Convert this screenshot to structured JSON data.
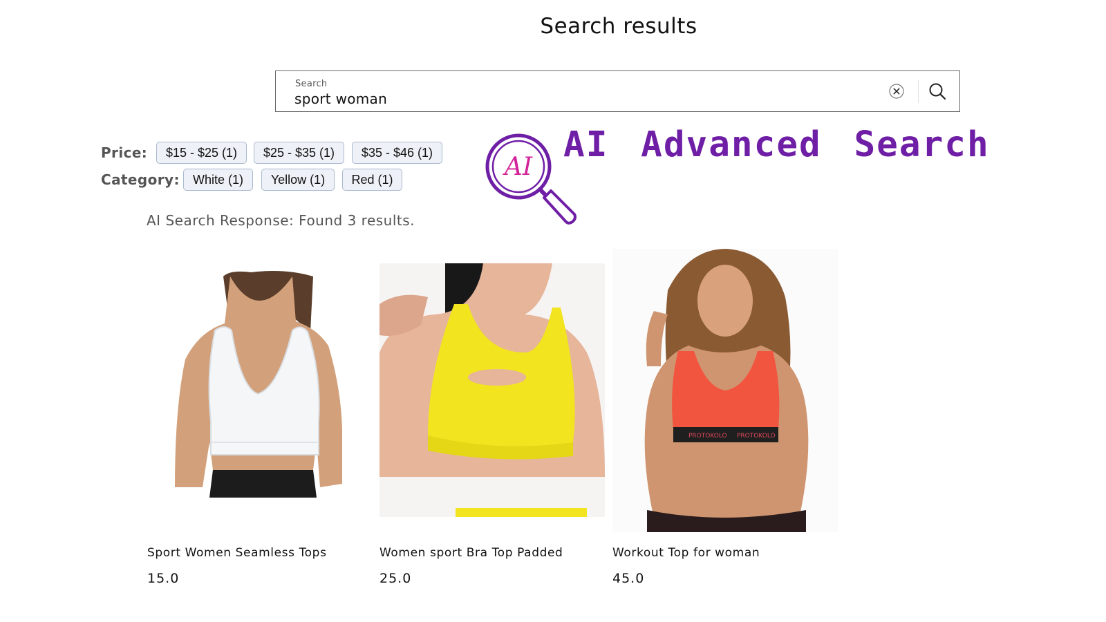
{
  "page": {
    "title": "Search results"
  },
  "search": {
    "label": "Search",
    "value": "sport woman",
    "clear_icon": "close-circle-icon",
    "submit_icon": "search-icon"
  },
  "filters": {
    "price_label": "Price:",
    "price_options": [
      "$15 - $25 (1)",
      "$25 - $35 (1)",
      "$35 - $46 (1)"
    ],
    "category_label": "Category:",
    "category_options": [
      "White (1)",
      "Yellow (1)",
      "Red (1)"
    ]
  },
  "ai": {
    "heading": "AI Advanced Search",
    "logo_text": "AI",
    "response": "AI Search Response: Found 3 results.",
    "accent": "#6f1ea6",
    "logo_text_color": "#d4239a"
  },
  "products": [
    {
      "title": "Sport Women Seamless Tops",
      "price": "15.0",
      "color": "#f4f6f8"
    },
    {
      "title": "Women sport Bra Top Padded",
      "price": "25.0",
      "color": "#f2e41f"
    },
    {
      "title": "Workout Top for woman",
      "price": "45.0",
      "color": "#f2553f"
    }
  ]
}
